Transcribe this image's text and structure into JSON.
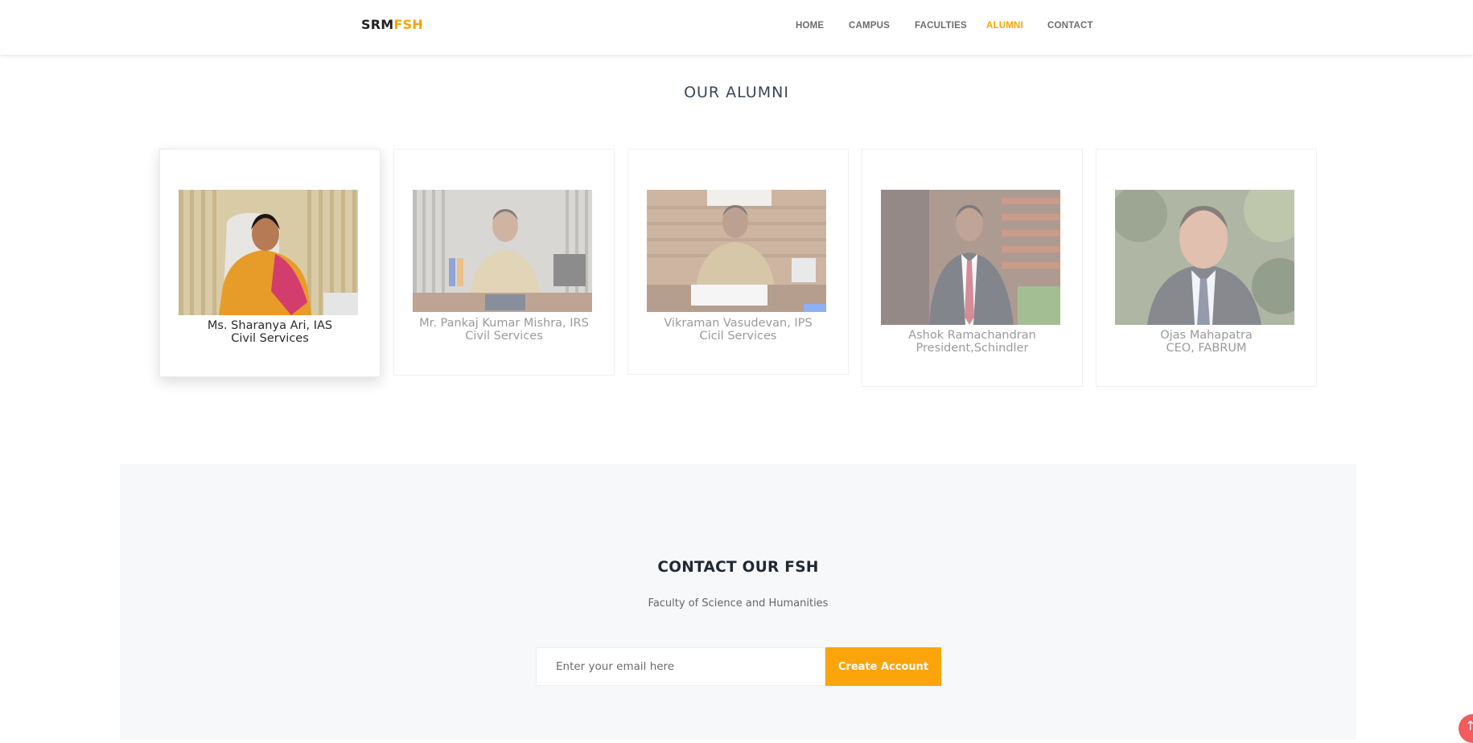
{
  "header": {
    "logo_primary": "SRM",
    "logo_accent": "FSH",
    "nav": [
      {
        "label": "HOME",
        "active": false
      },
      {
        "label": "CAMPUS",
        "active": false
      },
      {
        "label": "FACULTIES",
        "active": false
      },
      {
        "label": "ALUMNI",
        "active": true
      },
      {
        "label": "CONTACT",
        "active": false
      }
    ]
  },
  "alumni": {
    "title": "OUR ALUMNI",
    "cards": [
      {
        "name": "Ms. Sharanya Ari, IAS",
        "role": "Civil Services",
        "photo_icon": "woman-portrait-photo"
      },
      {
        "name": "Mr. Pankaj Kumar Mishra, IRS",
        "role": "Civil Services",
        "photo_icon": "officer-at-desk-photo"
      },
      {
        "name": "Vikraman Vasudevan, IPS",
        "role": "Cicil Services",
        "photo_icon": "police-officer-at-desk-photo"
      },
      {
        "name": "Ashok Ramachandran",
        "role": "President,Schindler",
        "photo_icon": "man-in-suit-photo"
      },
      {
        "name": "Ojas Mahapatra",
        "role": "CEO, FABRUM",
        "photo_icon": "man-in-suit-outdoor-photo"
      }
    ]
  },
  "contact": {
    "title": "CONTACT OUR FSH",
    "subtitle": "Faculty of Science and Humanities",
    "email_placeholder": "Enter your email here",
    "email_value": "",
    "button_label": "Create Account"
  },
  "scroll_top": {
    "icon": "arrow-up-icon",
    "color": "#f25c5c"
  },
  "colors": {
    "accent": "#f7a400",
    "button": "#fca40c"
  }
}
